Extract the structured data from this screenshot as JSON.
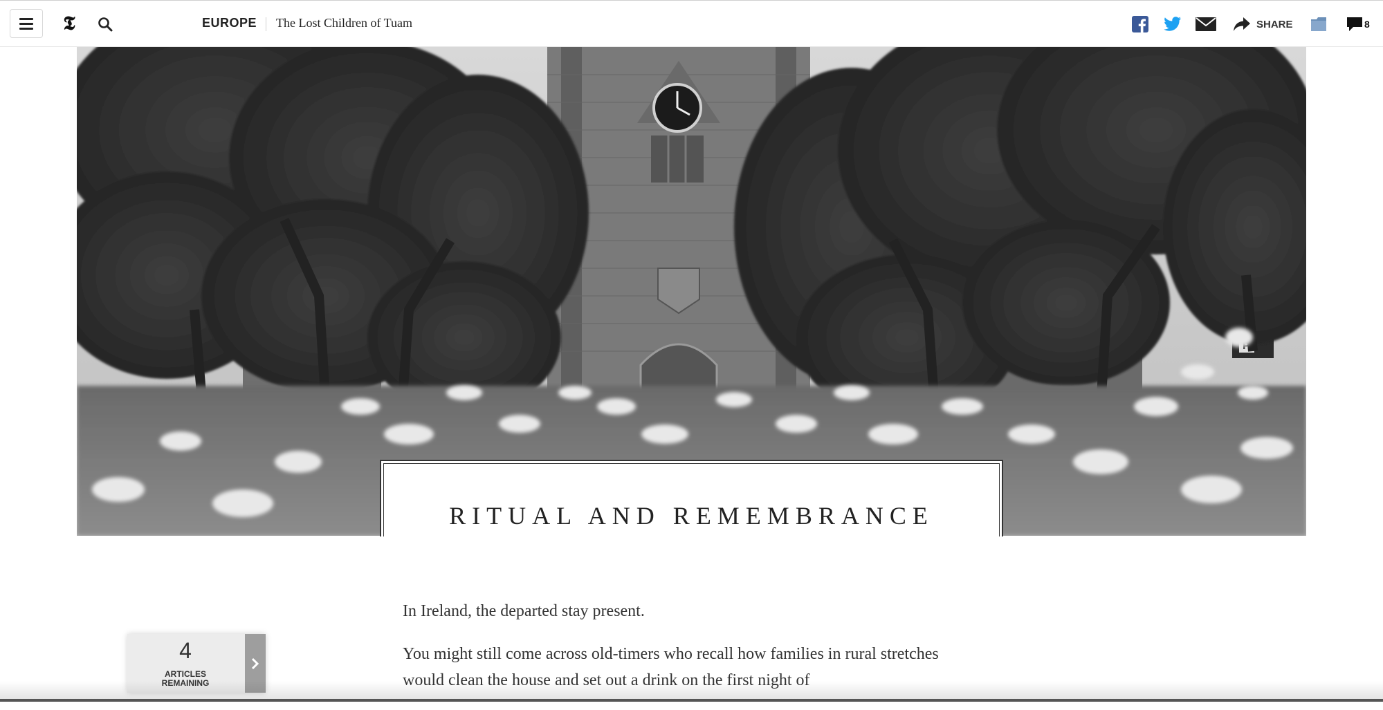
{
  "header": {
    "section": "EUROPE",
    "article_title": "The Lost Children of Tuam",
    "share_label": "SHARE",
    "comment_count": "8"
  },
  "icons": {
    "menu": "hamburger-icon",
    "logo": "nyt-t-logo",
    "search": "search-icon",
    "facebook": "facebook-icon",
    "twitter": "twitter-icon",
    "email": "mail-icon",
    "share": "share-arrow-icon",
    "save": "save-folder-icon",
    "comments": "comment-bubble-icon",
    "meter_next": "chevron-right-icon"
  },
  "colors": {
    "facebook": "#3b5998",
    "twitter": "#1da1f2",
    "save": "#6b8fb8",
    "text": "#333333"
  },
  "hero": {
    "kicker": "RITUAL AND REMEMBRANCE"
  },
  "body": {
    "paragraphs": [
      "In Ireland, the departed stay present.",
      "You might still come across old-timers who recall how families in rural stretches would clean the house and set out a drink on the first night of"
    ]
  },
  "meter": {
    "count": "4",
    "label_line1": "ARTICLES",
    "label_line2": "REMAINING"
  }
}
